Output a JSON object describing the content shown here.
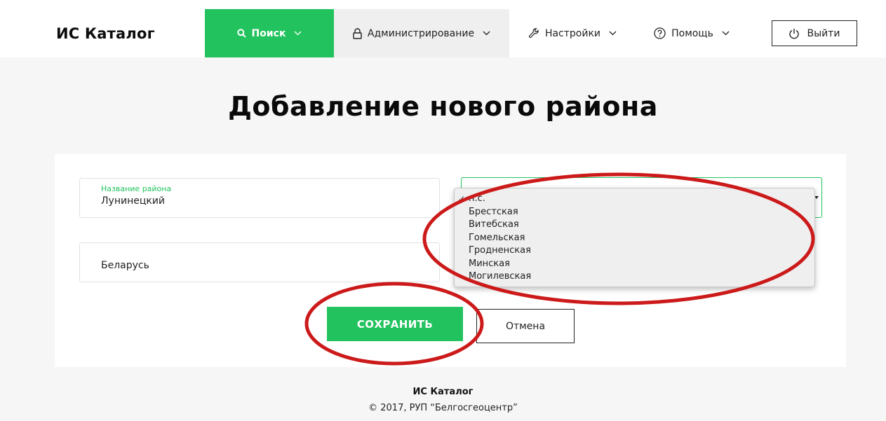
{
  "header": {
    "logo": "ИС Каталог",
    "nav": {
      "search": "Поиск",
      "admin": "Администрирование",
      "settings": "Настройки",
      "help": "Помощь"
    },
    "logout": "Выйти",
    "accent_color": "#22c35e"
  },
  "page_title": "Добавление нового района",
  "form": {
    "name_field": {
      "label": "Название района",
      "value": "Лунинецкий"
    },
    "country_field": {
      "value": "Беларусь"
    },
    "region_select": {
      "options": [
        "н.с.",
        "Брестская",
        "Витебская",
        "Гомельская",
        "Гродненская",
        "Минская",
        "Могилевская"
      ],
      "checked": "н.с."
    },
    "save_label": "СОХРАНИТЬ",
    "cancel_label": "Отмена"
  },
  "footer": {
    "title": "ИС Каталог",
    "copyright": "© 2017, РУП “Белгосгеоцентр”"
  },
  "annotation_color": "#cc1a1a"
}
